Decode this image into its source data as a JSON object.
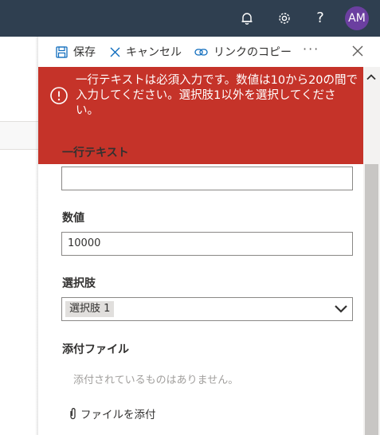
{
  "suitebar": {
    "help_glyph": "?",
    "avatar_initials": "AM"
  },
  "commandbar": {
    "save_label": "保存",
    "cancel_label": "キャンセル",
    "copy_link_label": "リンクのコピー",
    "more_label": "···"
  },
  "error": {
    "message": "一行テキストは必須入力です。数値は10から20の間で入力してください。選択肢1以外を選択してください。"
  },
  "form": {
    "single_line": {
      "label": "一行テキスト",
      "value": ""
    },
    "number": {
      "label": "数値",
      "value": "10000"
    },
    "choice": {
      "label": "選択肢",
      "selected": "選択肢 1"
    },
    "attachments": {
      "label": "添付ファイル",
      "empty_text": "添付されているものはありません。",
      "attach_label": "ファイルを添付"
    }
  },
  "colors": {
    "suitebar": "#2f3f50",
    "error_banner": "#c53329",
    "avatar": "#6b3fa0"
  },
  "icons": [
    "bell-icon",
    "gear-icon",
    "help-icon",
    "save-icon",
    "cancel-x-icon",
    "link-icon",
    "close-icon",
    "error-circle-icon",
    "chevron-down-icon",
    "paperclip-icon"
  ]
}
